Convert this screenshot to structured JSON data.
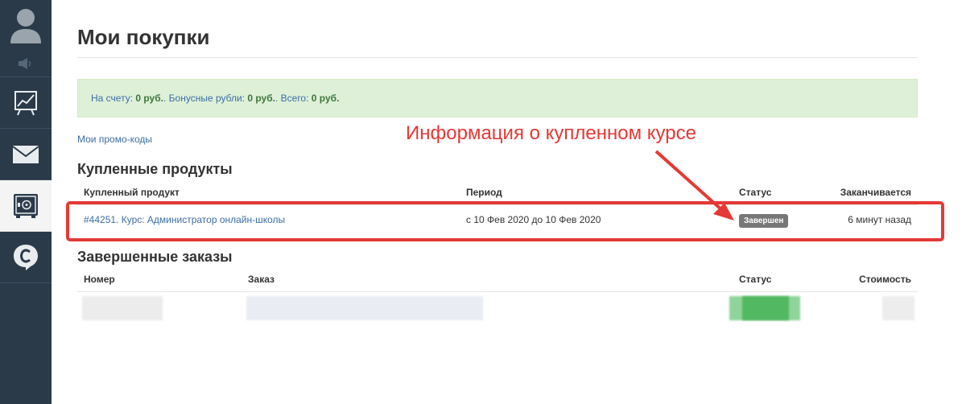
{
  "page": {
    "title": "Мои покупки"
  },
  "balance": {
    "account_label": "На счету:",
    "account_value": "0 руб.",
    "bonus_label": "Бонусные рубли:",
    "bonus_value": "0 руб.",
    "total_label": "Всего:",
    "total_value": "0 руб."
  },
  "promo_link": "Мои промо-коды",
  "purchased": {
    "title": "Купленные продукты",
    "columns": {
      "product": "Купленный продукт",
      "period": "Период",
      "status": "Статус",
      "expires": "Заканчивается"
    },
    "rows": [
      {
        "product": "#44251. Курс: Администратор онлайн-школы",
        "period": "с 10 Фев 2020 до 10 Фев 2020",
        "status": "Завершен",
        "expires": "6 минут назад"
      }
    ]
  },
  "orders": {
    "title": "Завершенные заказы",
    "columns": {
      "number": "Номер",
      "order": "Заказ",
      "status": "Статус",
      "cost": "Стоимость"
    }
  },
  "annotation": {
    "text": "Информация о купленном курсе",
    "color": "#e53935"
  },
  "sidebar": {
    "icons": [
      "user-icon",
      "speaker-icon",
      "chart-icon",
      "mail-icon",
      "safe-icon",
      "chat-c-icon"
    ]
  },
  "colors": {
    "sidebar": "#2b3a49",
    "link": "#3b6ea5",
    "success_bg": "#dff0d8",
    "badge": "#777777"
  }
}
